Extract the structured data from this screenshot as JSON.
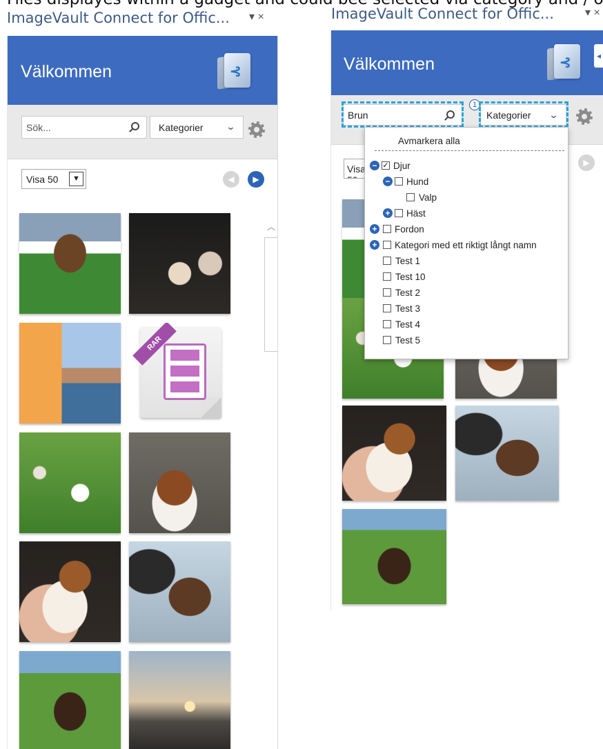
{
  "caption": "Files displayes within a gadget and could bee selected via category and / o",
  "panes": [
    {
      "title": "ImageVault Connect for Offic...",
      "controls": "▾ ×",
      "welcome": "Välkommen",
      "search": {
        "value": "",
        "placeholder": "Sök..."
      },
      "category_label": "Kategorier",
      "visa_label": "Visa 50"
    },
    {
      "title": "ImageVault Connect for Offic...",
      "controls": "▾ ×",
      "welcome": "Välkommen",
      "search": {
        "value": "Brun",
        "placeholder": "Sök..."
      },
      "category_label": "Kategorier",
      "visa_label": "Visa 50",
      "badge": "1"
    }
  ],
  "category_dropdown": {
    "clear_all": "Avmarkera alla",
    "items": [
      {
        "label": "Djur",
        "checked": true,
        "toggle": "collapse"
      },
      {
        "label": "Hund",
        "checked": false,
        "toggle": "collapse"
      },
      {
        "label": "Valp",
        "checked": false,
        "toggle": "none"
      },
      {
        "label": "Häst",
        "checked": false,
        "toggle": "expand"
      },
      {
        "label": "Fordon",
        "checked": false,
        "toggle": "expand"
      },
      {
        "label": "Kategori med ett riktigt långt namn",
        "checked": false,
        "toggle": "expand"
      },
      {
        "label": "Test 1",
        "checked": false,
        "toggle": "none"
      },
      {
        "label": "Test 10",
        "checked": false,
        "toggle": "none"
      },
      {
        "label": "Test 2",
        "checked": false,
        "toggle": "none"
      },
      {
        "label": "Test 3",
        "checked": false,
        "toggle": "none"
      },
      {
        "label": "Test 4",
        "checked": false,
        "toggle": "none"
      },
      {
        "label": "Test 5",
        "checked": false,
        "toggle": "none"
      }
    ]
  },
  "left_thumbnails": [
    "harness-race-photo",
    "winner-ceremony-photo",
    "food-and-harbor-photo",
    "rar-archive-icon",
    "puppy-in-grass-photo",
    "puppy-lying-photo",
    "puppy-in-hand-photo",
    "foal-photo",
    "horse-lying-in-grass-photo",
    "sunset-photo"
  ],
  "right_thumbnails": [
    "harness-race-photo",
    "puppy-in-grass-photo",
    "puppy-lying-photo",
    "puppy-in-hand-photo",
    "foal-photo",
    "horse-lying-in-grass-photo"
  ],
  "colors": {
    "banner": "#3d6bbf",
    "toolbar": "#e9e9e9",
    "accent": "#2c64b6",
    "highlight": "#2aa3dd",
    "rar": "#a04ea8"
  }
}
